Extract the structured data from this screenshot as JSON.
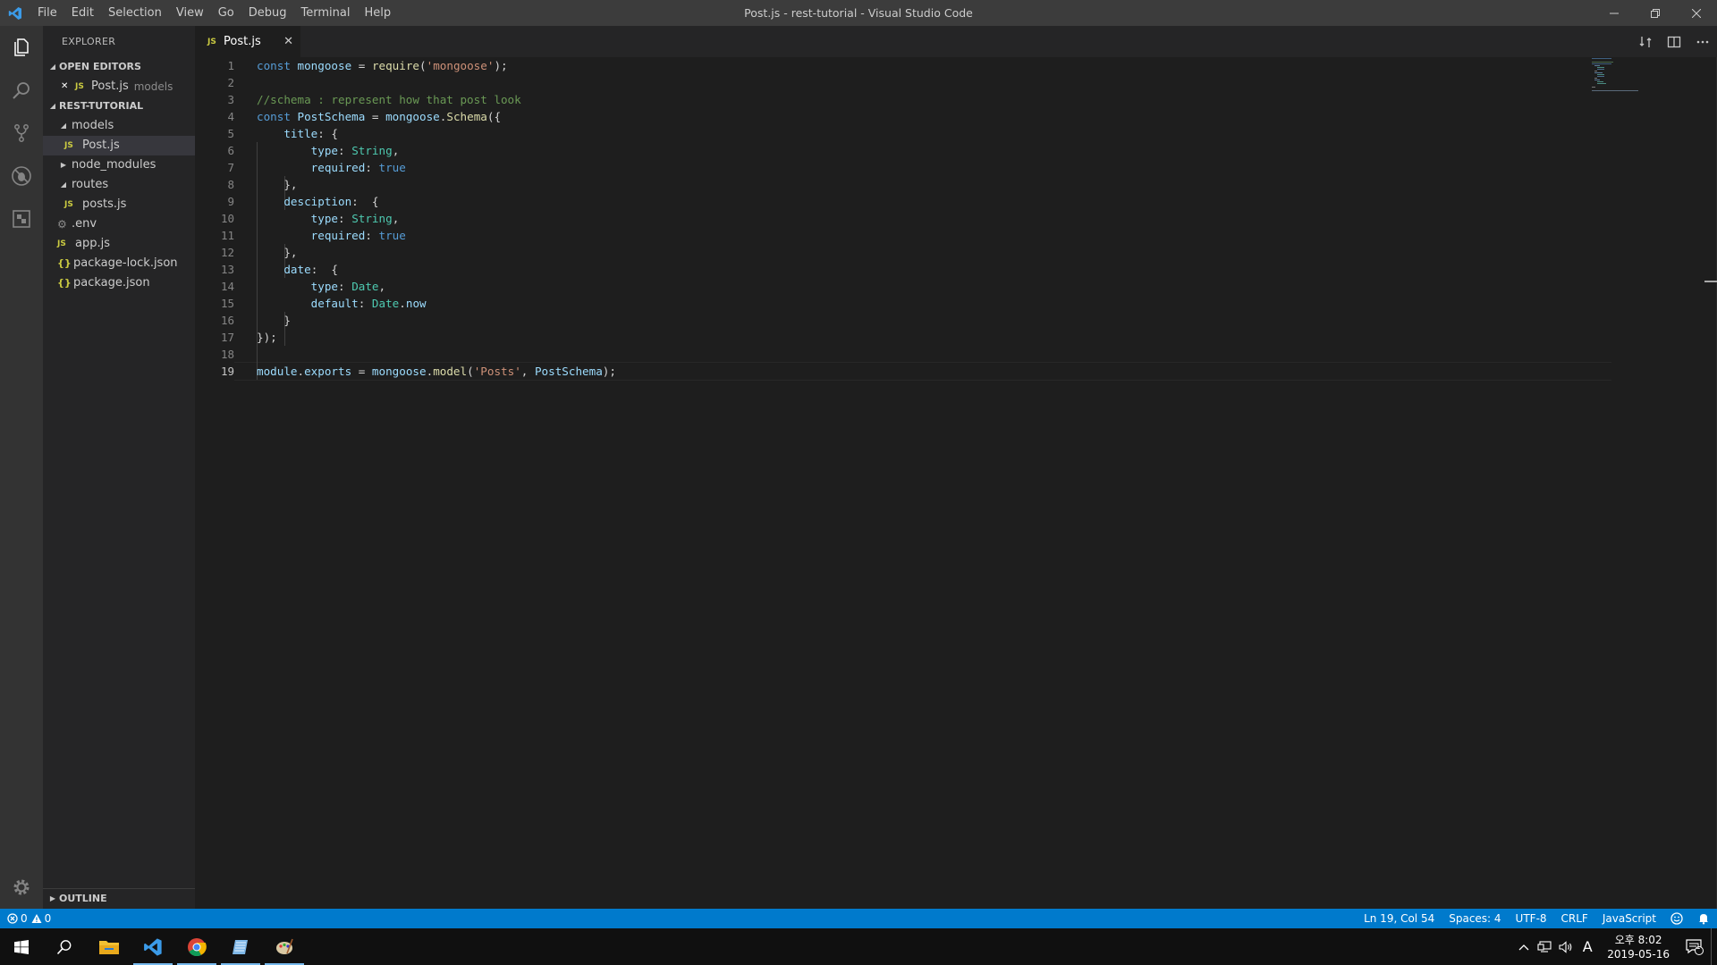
{
  "window": {
    "title": "Post.js - rest-tutorial - Visual Studio Code",
    "menu": [
      "File",
      "Edit",
      "Selection",
      "View",
      "Go",
      "Debug",
      "Terminal",
      "Help"
    ]
  },
  "activity_bar": {
    "items": [
      {
        "name": "explorer-icon"
      },
      {
        "name": "search-icon"
      },
      {
        "name": "source-control-icon"
      },
      {
        "name": "debug-icon"
      },
      {
        "name": "extensions-icon"
      },
      {
        "name": "gear-icon"
      }
    ]
  },
  "sidebar": {
    "header": "EXPLORER",
    "open_editors": {
      "label": "OPEN EDITORS",
      "items": [
        {
          "close": "✕",
          "badge": "JS",
          "name": "Post.js",
          "desc": "models"
        }
      ]
    },
    "project": {
      "label": "REST-TUTORIAL",
      "tree": [
        {
          "twisty": "◢",
          "name": "models",
          "type": "folder"
        },
        {
          "badge": "JS",
          "name": "Post.js",
          "type": "js",
          "selected": true
        },
        {
          "twisty": "▶",
          "name": "node_modules",
          "type": "folder"
        },
        {
          "twisty": "◢",
          "name": "routes",
          "type": "folder"
        },
        {
          "badge": "JS",
          "name": "posts.js",
          "type": "js"
        },
        {
          "badge": "⚙",
          "name": ".env",
          "type": "env"
        },
        {
          "badge": "JS",
          "name": "app.js",
          "type": "js"
        },
        {
          "badge": "{}",
          "name": "package-lock.json",
          "type": "json"
        },
        {
          "badge": "{}",
          "name": "package.json",
          "type": "json"
        }
      ]
    },
    "outline_label": "OUTLINE"
  },
  "tab": {
    "badge": "JS",
    "name": "Post.js",
    "close": "✕"
  },
  "editor": {
    "active_line": 19,
    "lines": [
      "const mongoose = require('mongoose');",
      "",
      "//schema : represent how that post look",
      "const PostSchema = mongoose.Schema({",
      "    title: {",
      "        type: String,",
      "        required: true",
      "    },",
      "    desciption:  {",
      "        type: String,",
      "        required: true",
      "    },",
      "    date:  {",
      "        type: Date,",
      "        default: Date.now",
      "    }",
      "});",
      "",
      "module.exports = mongoose.model('Posts', PostSchema);"
    ]
  },
  "status_bar": {
    "errors": "0",
    "warnings": "0",
    "position": "Ln 19, Col 54",
    "spaces": "Spaces: 4",
    "encoding": "UTF-8",
    "eol": "CRLF",
    "language": "JavaScript"
  },
  "taskbar": {
    "time": "오후 8:02",
    "date": "2019-05-16",
    "ime": "A",
    "notifications": "1"
  },
  "colors": {
    "accent": "#007acc",
    "keyword": "#569cd6",
    "string": "#ce9178",
    "comment": "#6a9955",
    "type": "#4ec9b0",
    "variable": "#9cdcfe",
    "function": "#dcdcaa"
  }
}
